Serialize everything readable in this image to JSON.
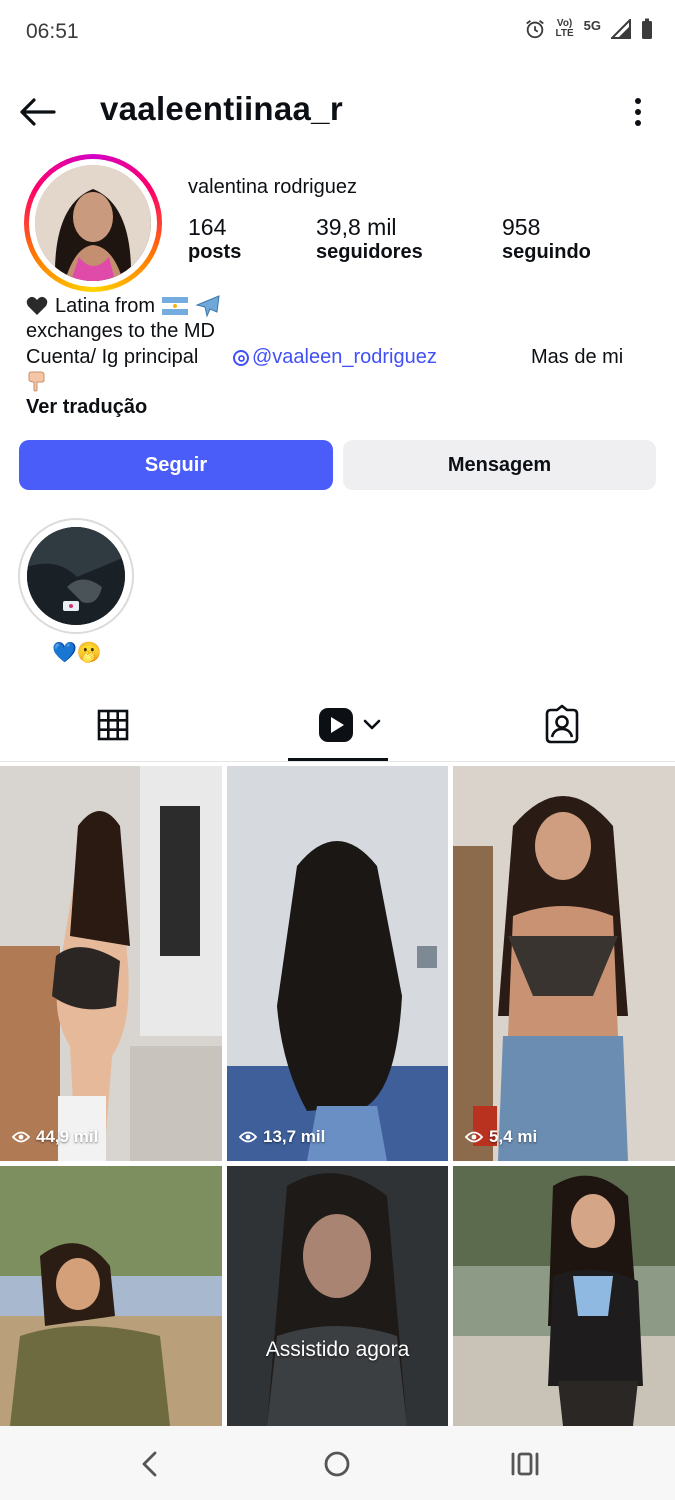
{
  "status_bar": {
    "time": "06:51",
    "volte_top": "Vo)",
    "volte_bottom": "LTE",
    "network": "5G"
  },
  "header": {
    "username": "vaaleentiinaa_r"
  },
  "profile": {
    "display_name": "valentina rodriguez",
    "stats": [
      {
        "value": "164",
        "label": "posts"
      },
      {
        "value": "39,8 mil",
        "label": "seguidores"
      },
      {
        "value": "958",
        "label": "seguindo"
      }
    ],
    "bio": {
      "line1_text": "Latina from",
      "line2": "exchanges to the MD",
      "line3_prefix": "Cuenta/ Ig principal",
      "line3_link": "@vaaleen_rodriguez",
      "line3_suffix": "Mas de mi",
      "translate": "Ver tradução"
    }
  },
  "actions": {
    "follow": "Seguir",
    "message": "Mensagem"
  },
  "highlight": {
    "label": "💙🫢"
  },
  "grid": {
    "tiles": [
      {
        "views": "44,9 mil"
      },
      {
        "views": "13,7 mil"
      },
      {
        "views": "5,4 mi"
      },
      {
        "views": ""
      },
      {
        "overlay": "Assistido agora"
      },
      {
        "views": ""
      }
    ]
  },
  "colors": {
    "follow_button": "#4a5df9",
    "link": "#4150f7",
    "message_button": "#efeff2"
  }
}
